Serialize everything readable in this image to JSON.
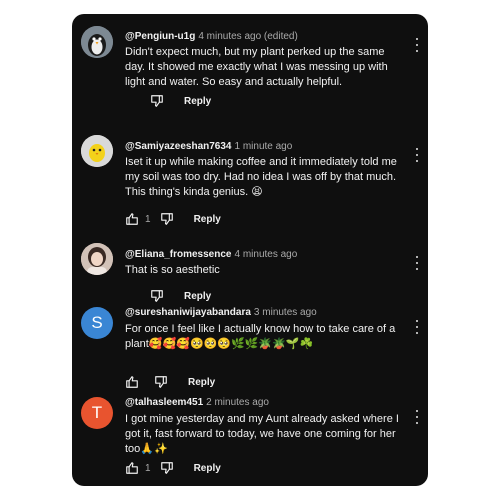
{
  "comments": [
    {
      "avatar": "penguin-avatar",
      "handle": "@Pengiun-u1g",
      "time": "4 minutes ago (edited)",
      "text": "Didn't expect much, but my plant perked up the same day. It showed me exactly what I was messing up with light and water. So easy and actually helpful.",
      "likes": "",
      "reply": "Reply"
    },
    {
      "avatar": "chick-avatar",
      "handle": "@Samiyazeeshan7634",
      "time": "1 minute ago",
      "text": "Iset it up while making coffee and it immediately told me my soil was too dry. Had no idea I was off by that much. This thing's kinda genius. 😫",
      "likes": "1",
      "reply": "Reply"
    },
    {
      "avatar": "photo-avatar",
      "handle": "@Eliana_fromessence",
      "time": "4 minutes ago",
      "text": "That is so aesthetic",
      "likes": "",
      "reply": "Reply"
    },
    {
      "avatar_letter": "S",
      "handle": "@sureshaniwijayabandara",
      "time": "3 minutes ago",
      "text": "For once I feel like I actually know how to take care of a plant🥰🥰🥰🥺🥺🥺🌿🌿🪴🪴🌱☘️",
      "likes": "",
      "reply": "Reply"
    },
    {
      "avatar_letter": "T",
      "handle": "@talhasleem451",
      "time": "2 minutes ago",
      "text": "I got mine yesterday and my Aunt already asked where I got it, fast forward to today, we have one coming for her too🙏✨",
      "likes": "1",
      "reply": "Reply"
    }
  ],
  "colors": {
    "panel_bg": "#0f0f0f",
    "text": "#f1f1f1",
    "secondary_text": "#aaaaaa",
    "avatar_s": "#3a86d4",
    "avatar_t": "#e8542f"
  }
}
